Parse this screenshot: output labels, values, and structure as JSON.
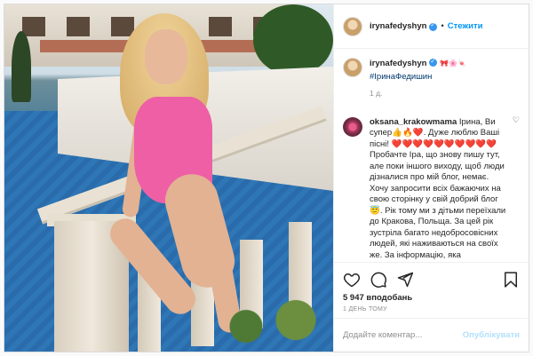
{
  "header": {
    "username": "irynafedyshyn",
    "dot": "•",
    "follow_label": "Стежити"
  },
  "caption": {
    "username": "irynafedyshyn",
    "emojis": "🎀🌸🍬",
    "hashtag": "#ІринаФедишин",
    "age": "1 д."
  },
  "comment": {
    "username": "oksana_krakowmama",
    "text": "Ірина, Ви супер👍🔥❤️. Дуже люблю Ваші пісні! ❤️❤️❤️❤️❤️❤️❤️❤️❤️❤️ Пробачте Іра, що знову пишу тут, але поки іншого виходу, щоб люди дізналися про мій блог, немає. Хочу запросити всіх бажаючих на свою сторінку у свій добрий блог 😇. Рік тому ми з дітьми переїхали до Кракова, Польща. За цей рік зустріла багато недобросовісних людей, які наживаються на своїх же. За інформацію, яка безкоштовна"
  },
  "likes": "5 947 вподобань",
  "time": "1 ДЕНЬ ТОМУ",
  "add_comment": {
    "placeholder": "Додайте коментар...",
    "publish_label": "Опублікувати"
  },
  "icons": {
    "like": "heart-icon",
    "comment": "comment-icon",
    "share": "share-icon",
    "save": "bookmark-icon",
    "comment_like": "heart-small-icon"
  },
  "colors": {
    "link": "#0095f6",
    "hashtag": "#00376b",
    "swimsuit": "#ee5fa6",
    "pool": "#2e76b6"
  }
}
